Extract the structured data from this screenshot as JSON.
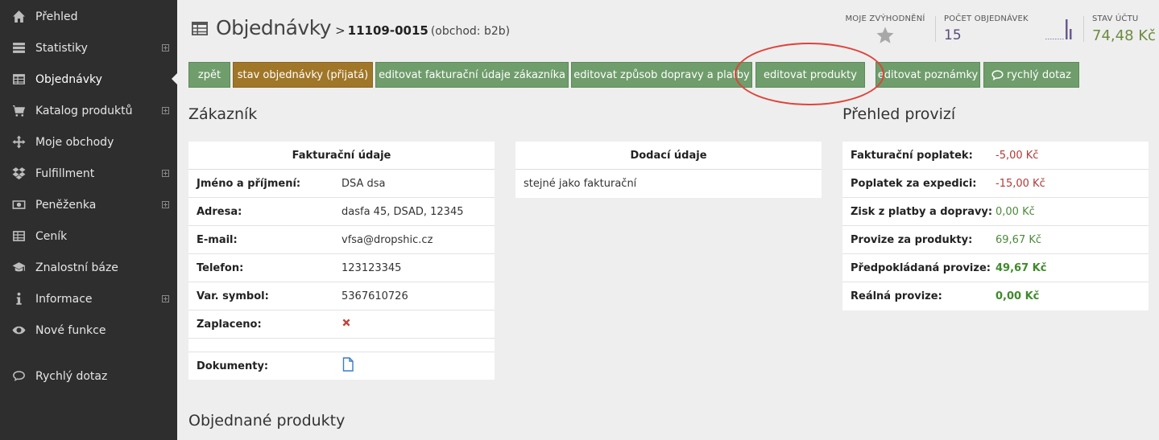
{
  "sidebar": {
    "items": [
      {
        "label": "Přehled",
        "icon": "home-icon",
        "expandable": false,
        "active": false
      },
      {
        "label": "Statistiky",
        "icon": "stats-icon",
        "expandable": true,
        "active": false
      },
      {
        "label": "Objednávky",
        "icon": "table-icon",
        "expandable": false,
        "active": true
      },
      {
        "label": "Katalog produktů",
        "icon": "cart-icon",
        "expandable": true,
        "active": false
      },
      {
        "label": "Moje obchody",
        "icon": "move-icon",
        "expandable": false,
        "active": false
      },
      {
        "label": "Fulfillment",
        "icon": "dropbox-icon",
        "expandable": true,
        "active": false
      },
      {
        "label": "Peněženka",
        "icon": "money-icon",
        "expandable": true,
        "active": false
      },
      {
        "label": "Ceník",
        "icon": "grid-icon",
        "expandable": false,
        "active": false
      },
      {
        "label": "Znalostní báze",
        "icon": "graduation-cap-icon",
        "expandable": false,
        "active": false
      },
      {
        "label": "Informace",
        "icon": "info-icon",
        "expandable": true,
        "active": false
      },
      {
        "label": "Nové funkce",
        "icon": "eye-icon",
        "expandable": false,
        "active": false
      },
      {
        "label": "Rychlý dotaz",
        "icon": "chat-icon",
        "expandable": false,
        "active": false
      }
    ]
  },
  "header": {
    "title": "Objednávky",
    "separator": ">",
    "order_number": "11109-0015",
    "shop": "(obchod: b2b)"
  },
  "stats": {
    "favorites_label": "MOJE ZVÝHODNĚNÍ",
    "orders_label": "POČET OBJEDNÁVEK",
    "orders_value": "15",
    "balance_label": "STAV ÚČTU",
    "balance_value": "74,48 Kč"
  },
  "toolbar": {
    "buttons": [
      {
        "label": "zpět",
        "kind": "default"
      },
      {
        "label": "stav objednávky (přijatá)",
        "kind": "status"
      },
      {
        "label": "editovat fakturační údaje zákazníka",
        "kind": "default"
      },
      {
        "label": "editovat způsob dopravy a platby",
        "kind": "default"
      },
      {
        "label": "editovat produkty",
        "kind": "default"
      },
      {
        "label": "editovat poznámky",
        "kind": "default"
      },
      {
        "label": "rychlý dotaz",
        "kind": "default"
      }
    ]
  },
  "customer": {
    "section_title": "Zákazník",
    "billing": {
      "header": "Fakturační údaje",
      "rows": [
        {
          "key": "Jméno a příjmení:",
          "value": "DSA dsa"
        },
        {
          "key": "Adresa:",
          "value": "dasfa 45, DSAD, 12345"
        },
        {
          "key": "E-mail:",
          "value": "vfsa@dropshic.cz"
        },
        {
          "key": "Telefon:",
          "value": "123123345"
        },
        {
          "key": "Var. symbol:",
          "value": "5367610726"
        },
        {
          "key": "Zaplaceno:",
          "value": ""
        },
        {
          "key": "",
          "value": ""
        },
        {
          "key": "Dokumenty:",
          "value": ""
        }
      ]
    },
    "delivery": {
      "header": "Dodací údaje",
      "rows": [
        {
          "value": "stejné jako fakturační"
        }
      ]
    }
  },
  "commission": {
    "section_title": "Přehled provizí",
    "rows": [
      {
        "key": "Fakturační poplatek:",
        "value": "-5,00 Kč",
        "tone": "neg"
      },
      {
        "key": "Poplatek za expedici:",
        "value": "-15,00 Kč",
        "tone": "neg"
      },
      {
        "key": "Zisk z platby a dopravy:",
        "value": "0,00 Kč",
        "tone": "pos"
      },
      {
        "key": "Provize za produkty:",
        "value": "69,67 Kč",
        "tone": "pos"
      },
      {
        "key": "Předpokládaná provize:",
        "value": "49,67 Kč",
        "tone": "posb"
      },
      {
        "key": "Reálná provize:",
        "value": "0,00 Kč",
        "tone": "posb"
      }
    ]
  },
  "products": {
    "section_title": "Objednané produkty"
  },
  "colors": {
    "sidebar_bg": "#2e2e2e",
    "button_green": "#6f9d6b",
    "button_status": "#a07628",
    "annotation_red": "#e0423a",
    "balance_green": "#6d8b3f"
  }
}
